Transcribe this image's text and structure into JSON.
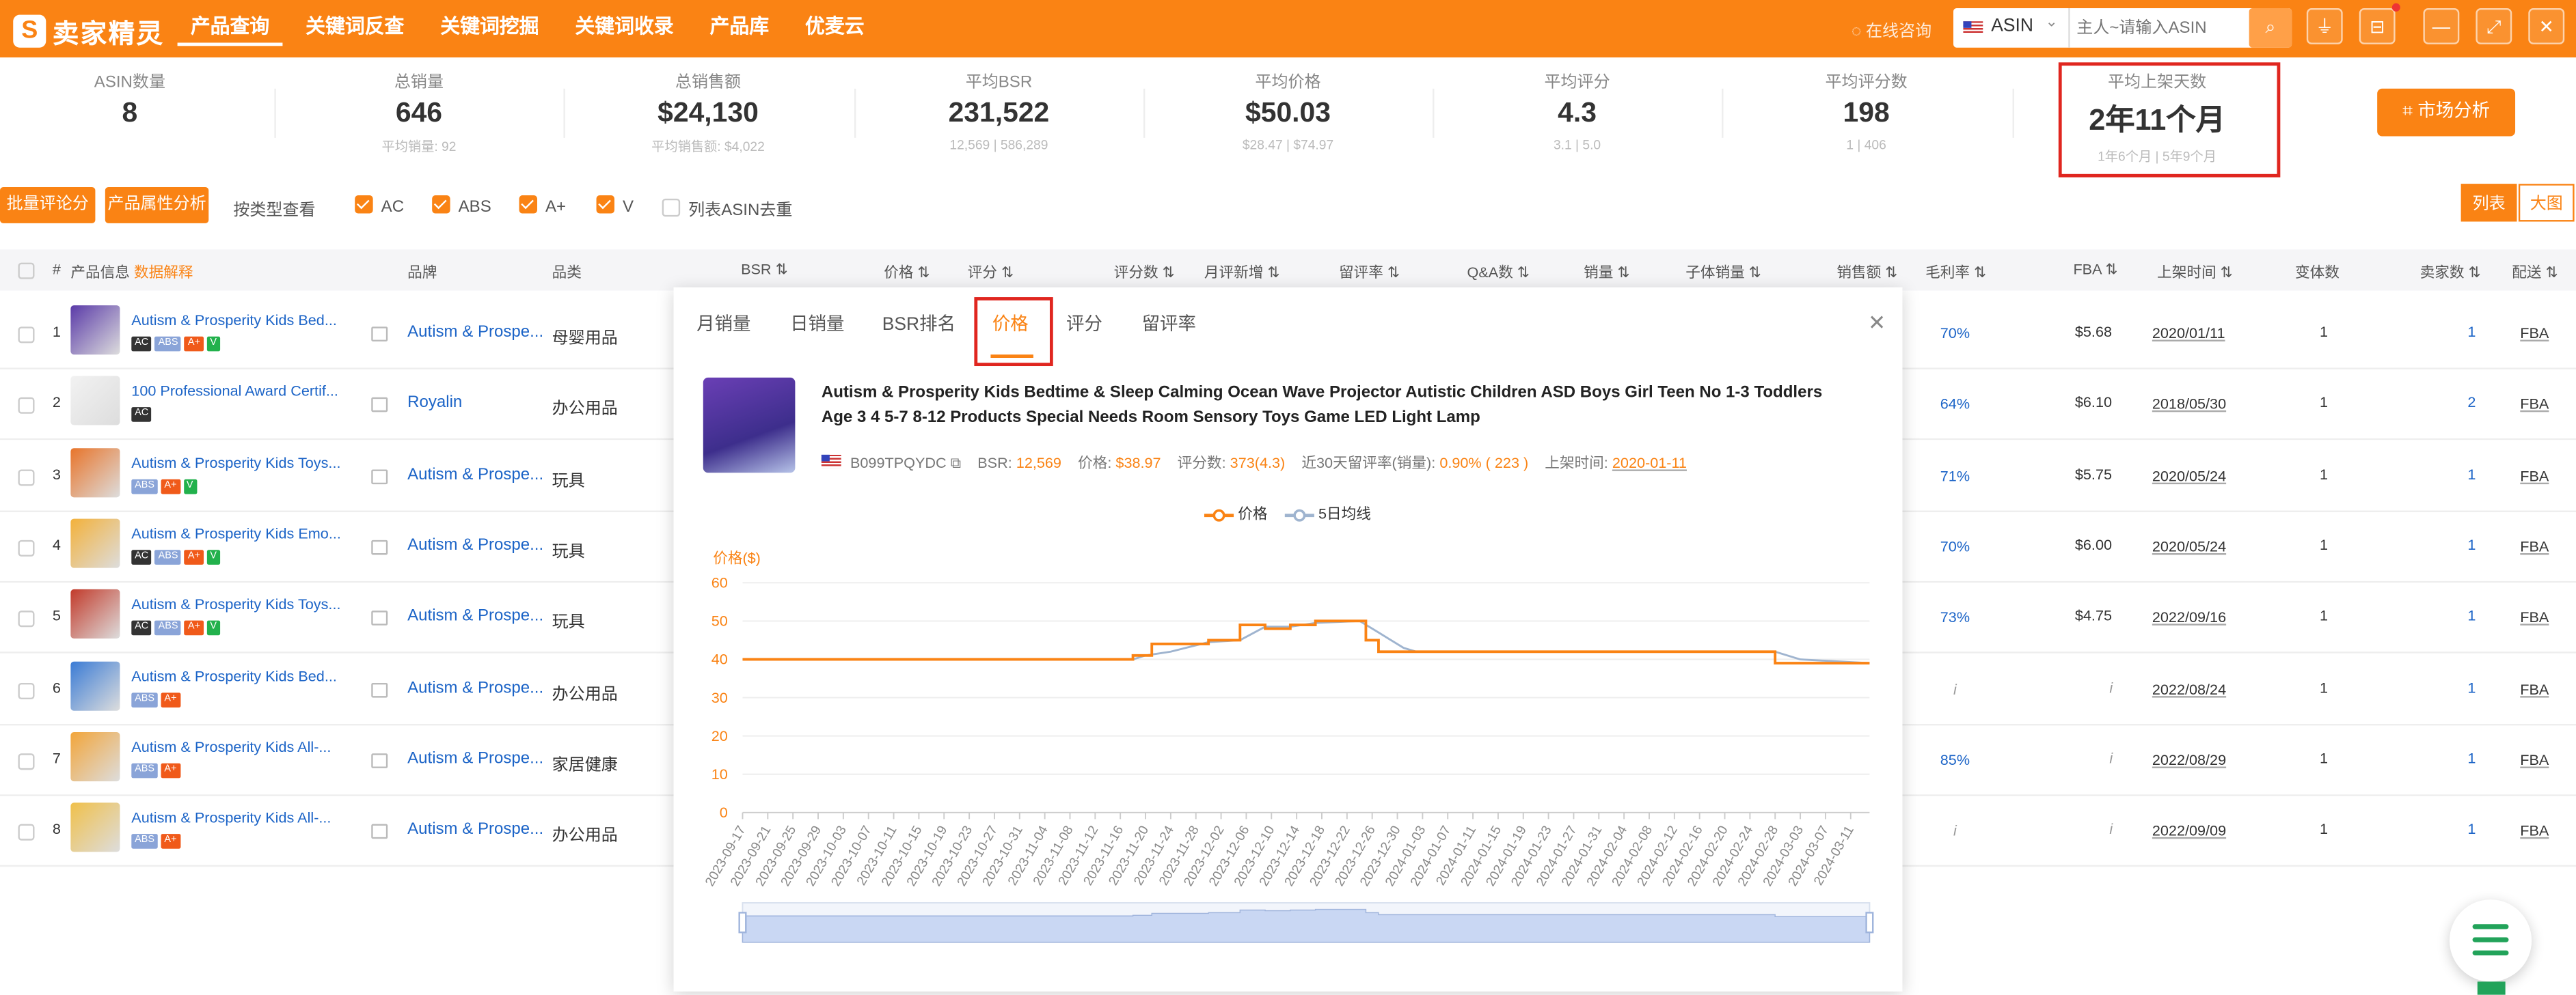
{
  "app": {
    "logo_text": "卖家精灵"
  },
  "nav": [
    {
      "label": "产品查询",
      "active": true
    },
    {
      "label": "关键词反查"
    },
    {
      "label": "关键词挖掘"
    },
    {
      "label": "关键词收录"
    },
    {
      "label": "产品库"
    },
    {
      "label": "优麦云"
    }
  ],
  "header": {
    "online_label": "在线咨询",
    "asin_select": "ASIN",
    "search_placeholder": "主人~请输入ASIN"
  },
  "stats": [
    {
      "label": "ASIN数量",
      "value": "8",
      "sub": ""
    },
    {
      "label": "总销量",
      "value": "646",
      "sub": "平均销量: 92"
    },
    {
      "label": "总销售额",
      "value": "$24,130",
      "sub": "平均销售额: $4,022"
    },
    {
      "label": "平均BSR",
      "value": "231,522",
      "sub": "12,569  |  586,289"
    },
    {
      "label": "平均价格",
      "value": "$50.03",
      "sub": "$28.47  |  $74.97"
    },
    {
      "label": "平均评分",
      "value": "4.3",
      "sub": "3.1  |  5.0"
    },
    {
      "label": "平均评分数",
      "value": "198",
      "sub": "1  |  406"
    },
    {
      "label": "平均上架天数",
      "value": "2年11个月",
      "sub": "1年6个月  |  5年9个月"
    }
  ],
  "market_button": "市场分析",
  "toolbar": {
    "batch_review": "批量评论分析",
    "attr_analysis": "产品属性分析",
    "type_view": "按类型查看",
    "filters": [
      "AC",
      "ABS",
      "A+",
      "V"
    ],
    "dedupe": "列表ASIN去重",
    "view_list": "列表",
    "view_grid": "大图"
  },
  "table": {
    "headers": {
      "num": "#",
      "info": "产品信息",
      "info_tag": "数据解释",
      "brand": "品牌",
      "category": "品类",
      "bsr": "BSR",
      "price": "价格",
      "rating": "评分",
      "reviews": "评分数",
      "monthly_new": "月评新增",
      "retention": "留评率",
      "qa": "Q&A数",
      "sales": "销量",
      "child_sales": "子体销量",
      "revenue": "销售额",
      "margin": "毛利率",
      "fba": "FBA",
      "date": "上架时间",
      "variants": "变体数",
      "sellers": "卖家数",
      "delivery": "配送"
    },
    "rows": [
      {
        "no": "1",
        "title": "Autism & Prosperity Kids Bed...",
        "badges": [
          "AC",
          "ABS",
          "A+",
          "V"
        ],
        "brand": "Autism & Prospe...",
        "category": "母婴用品",
        "margin": "70%",
        "fba": "$5.68",
        "date": "2020/01/11",
        "variants": "1",
        "sellers": "1",
        "delivery": "FBA"
      },
      {
        "no": "2",
        "title": "100 Professional Award Certif...",
        "badges": [
          "AC"
        ],
        "brand": "Royalin",
        "category": "办公用品",
        "margin": "64%",
        "fba": "$6.10",
        "date": "2018/05/30",
        "variants": "1",
        "sellers": "2",
        "delivery": "FBA"
      },
      {
        "no": "3",
        "title": "Autism & Prosperity Kids Toys...",
        "badges": [
          "ABS",
          "A+",
          "V"
        ],
        "brand": "Autism & Prospe...",
        "category": "玩具",
        "margin": "71%",
        "fba": "$5.75",
        "date": "2020/05/24",
        "variants": "1",
        "sellers": "1",
        "delivery": "FBA"
      },
      {
        "no": "4",
        "title": "Autism & Prosperity Kids Emo...",
        "badges": [
          "AC",
          "ABS",
          "A+",
          "V"
        ],
        "brand": "Autism & Prospe...",
        "category": "玩具",
        "margin": "70%",
        "fba": "$6.00",
        "date": "2020/05/24",
        "variants": "1",
        "sellers": "1",
        "delivery": "FBA"
      },
      {
        "no": "5",
        "title": "Autism & Prosperity Kids Toys...",
        "badges": [
          "AC",
          "ABS",
          "A+",
          "V"
        ],
        "brand": "Autism & Prospe...",
        "category": "玩具",
        "margin": "73%",
        "fba": "$4.75",
        "date": "2022/09/16",
        "variants": "1",
        "sellers": "1",
        "delivery": "FBA"
      },
      {
        "no": "6",
        "title": "Autism & Prosperity Kids Bed...",
        "badges": [
          "ABS",
          "A+"
        ],
        "brand": "Autism & Prospe...",
        "category": "办公用品",
        "margin": "i",
        "fba": "i",
        "date": "2022/08/24",
        "variants": "1",
        "sellers": "1",
        "delivery": "FBA"
      },
      {
        "no": "7",
        "title": "Autism & Prosperity Kids All-...",
        "badges": [
          "ABS",
          "A+"
        ],
        "brand": "Autism & Prospe...",
        "category": "家居健康",
        "margin": "85%",
        "fba": "i",
        "date": "2022/08/29",
        "variants": "1",
        "sellers": "1",
        "delivery": "FBA"
      },
      {
        "no": "8",
        "title": "Autism & Prosperity Kids All-...",
        "badges": [
          "ABS",
          "A+"
        ],
        "brand": "Autism & Prospe...",
        "category": "办公用品",
        "margin": "i",
        "fba": "i",
        "date": "2022/09/09",
        "variants": "1",
        "sellers": "1",
        "delivery": "FBA"
      }
    ]
  },
  "popup": {
    "tabs": [
      "月销量",
      "日销量",
      "BSR排名",
      "价格",
      "评分",
      "留评率"
    ],
    "active_tab": "价格",
    "product": {
      "title": "Autism & Prosperity Kids Bedtime & Sleep Calming Ocean Wave Projector Autistic Children ASD Boys Girl Teen No 1-3 Toddlers Age 3 4 5-7 8-12 Products Special Needs Room Sensory Toys Game LED Light Lamp",
      "asin": "B099TPQYDC",
      "bsr_label": "BSR:",
      "bsr": "12,569",
      "price_label": "价格:",
      "price": "$38.97",
      "rating_label": "评分数:",
      "rating": "373(4.3)",
      "retention_label": "近30天留评率(销量):",
      "retention": "0.90% ( 223 )",
      "date_label": "上架时间:",
      "date": "2020-01-11"
    },
    "legend": {
      "price": "价格",
      "ma5": "5日均线"
    }
  },
  "colors": {
    "brand": "#fa8314",
    "highlight": "#e0261f",
    "link": "#1c64c7",
    "ma_line": "#9fb4cf"
  },
  "chart_data": {
    "type": "line",
    "ylabel": "价格($)",
    "ylim": [
      0,
      60
    ],
    "yticks": [
      0,
      10,
      20,
      30,
      40,
      50,
      60
    ],
    "x_ticks": [
      "2023-09-17",
      "2023-09-21",
      "2023-09-25",
      "2023-09-29",
      "2023-10-03",
      "2023-10-07",
      "2023-10-11",
      "2023-10-15",
      "2023-10-19",
      "2023-10-23",
      "2023-10-27",
      "2023-10-31",
      "2023-11-04",
      "2023-11-08",
      "2023-11-12",
      "2023-11-16",
      "2023-11-20",
      "2023-11-24",
      "2023-11-28",
      "2023-12-02",
      "2023-12-06",
      "2023-12-10",
      "2023-12-14",
      "2023-12-18",
      "2023-12-22",
      "2023-12-26",
      "2023-12-30",
      "2024-01-03",
      "2024-01-07",
      "2024-01-11",
      "2024-01-15",
      "2024-01-19",
      "2024-01-23",
      "2024-01-27",
      "2024-01-31",
      "2024-02-04",
      "2024-02-08",
      "2024-02-12",
      "2024-02-16",
      "2024-02-20",
      "2024-02-24",
      "2024-02-28",
      "2024-03-03",
      "2024-03-07",
      "2024-03-11"
    ],
    "series": [
      {
        "name": "价格",
        "color": "#fa8314",
        "points": [
          [
            "2023-09-17",
            40
          ],
          [
            "2023-11-18",
            40
          ],
          [
            "2023-11-18",
            41
          ],
          [
            "2023-11-21",
            41
          ],
          [
            "2023-11-21",
            44
          ],
          [
            "2023-11-30",
            44
          ],
          [
            "2023-11-30",
            45
          ],
          [
            "2023-12-05",
            45
          ],
          [
            "2023-12-05",
            49
          ],
          [
            "2023-12-09",
            49
          ],
          [
            "2023-12-09",
            48
          ],
          [
            "2023-12-13",
            48
          ],
          [
            "2023-12-13",
            49
          ],
          [
            "2023-12-17",
            49
          ],
          [
            "2023-12-17",
            50
          ],
          [
            "2023-12-25",
            50
          ],
          [
            "2023-12-25",
            45
          ],
          [
            "2023-12-27",
            45
          ],
          [
            "2023-12-27",
            42
          ],
          [
            "2024-02-28",
            42
          ],
          [
            "2024-02-28",
            39
          ],
          [
            "2024-03-14",
            39
          ]
        ]
      },
      {
        "name": "5日均线",
        "color": "#9fb4cf",
        "points": [
          [
            "2023-09-17",
            40
          ],
          [
            "2023-11-18",
            40
          ],
          [
            "2023-11-20",
            41
          ],
          [
            "2023-11-24",
            42
          ],
          [
            "2023-11-30",
            44.5
          ],
          [
            "2023-12-05",
            45
          ],
          [
            "2023-12-09",
            48.5
          ],
          [
            "2023-12-13",
            48.5
          ],
          [
            "2023-12-17",
            49.5
          ],
          [
            "2023-12-24",
            50
          ],
          [
            "2023-12-27",
            47
          ],
          [
            "2023-12-31",
            43
          ],
          [
            "2024-01-02",
            42
          ],
          [
            "2024-02-28",
            42
          ],
          [
            "2024-03-03",
            40
          ],
          [
            "2024-03-14",
            39
          ]
        ]
      }
    ],
    "legend_position": "top-center",
    "grid": true
  }
}
